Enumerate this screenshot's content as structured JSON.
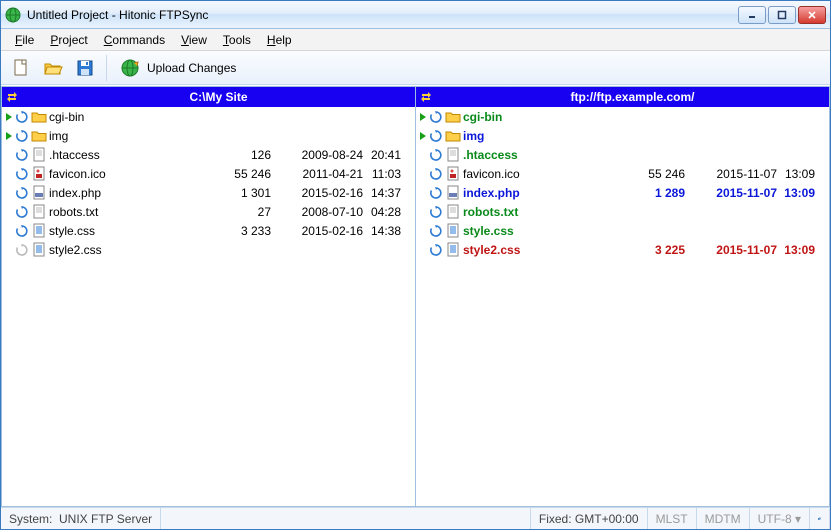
{
  "window": {
    "title": "Untitled Project - Hitonic FTPSync"
  },
  "menu": {
    "file": "File",
    "project": "Project",
    "commands": "Commands",
    "view": "View",
    "tools": "Tools",
    "help": "Help"
  },
  "toolbar": {
    "upload_label": "Upload Changes"
  },
  "panes": {
    "left": {
      "title": "C:\\My Site",
      "items": [
        {
          "type": "dir",
          "name": "cgi-bin",
          "dirflag": "<DIR>",
          "color": "black",
          "arrow": true
        },
        {
          "type": "dir",
          "name": "img",
          "dirflag": "<DIR>",
          "color": "black",
          "arrow": true
        },
        {
          "type": "file",
          "icon": "doc",
          "name": ".htaccess",
          "size": "126",
          "date": "2009-08-24",
          "time": "20:41",
          "color": "black"
        },
        {
          "type": "file",
          "icon": "img",
          "name": "favicon.ico",
          "size": "55 246",
          "date": "2011-04-21",
          "time": "11:03",
          "color": "black"
        },
        {
          "type": "file",
          "icon": "php",
          "name": "index.php",
          "size": "1 301",
          "date": "2015-02-16",
          "time": "14:37",
          "color": "black"
        },
        {
          "type": "file",
          "icon": "doc",
          "name": "robots.txt",
          "size": "27",
          "date": "2008-07-10",
          "time": "04:28",
          "color": "black"
        },
        {
          "type": "file",
          "icon": "css",
          "name": "style.css",
          "size": "3 233",
          "date": "2015-02-16",
          "time": "14:38",
          "color": "black"
        },
        {
          "type": "file",
          "icon": "css",
          "name": "style2.css",
          "size": "",
          "date": "",
          "time": "",
          "color": "black",
          "dim": true
        }
      ]
    },
    "right": {
      "title": "ftp://ftp.example.com/",
      "items": [
        {
          "type": "dir",
          "name": "cgi-bin",
          "dirflag": "<DIR>",
          "color": "green",
          "arrow": true,
          "bold": true
        },
        {
          "type": "dir",
          "name": "img",
          "dirflag": "<DIR>",
          "color": "blue",
          "arrow": true,
          "bold": true
        },
        {
          "type": "file",
          "icon": "doc",
          "name": ".htaccess",
          "size": "",
          "date": "",
          "time": "",
          "color": "green",
          "bold": true
        },
        {
          "type": "file",
          "icon": "img",
          "name": "favicon.ico",
          "size": "55 246",
          "date": "2015-11-07",
          "time": "13:09",
          "color": "black"
        },
        {
          "type": "file",
          "icon": "php",
          "name": "index.php",
          "size": "1 289",
          "date": "2015-11-07",
          "time": "13:09",
          "color": "blue",
          "bold": true
        },
        {
          "type": "file",
          "icon": "doc",
          "name": "robots.txt",
          "size": "",
          "date": "",
          "time": "",
          "color": "green",
          "bold": true
        },
        {
          "type": "file",
          "icon": "css",
          "name": "style.css",
          "size": "",
          "date": "",
          "time": "",
          "color": "green",
          "bold": true
        },
        {
          "type": "file",
          "icon": "css",
          "name": "style2.css",
          "size": "3 225",
          "date": "2015-11-07",
          "time": "13:09",
          "color": "red",
          "bold": true
        }
      ]
    }
  },
  "status": {
    "system_label": "System:",
    "system_value": "UNIX FTP Server",
    "tz": "Fixed: GMT+00:00",
    "mlst": "MLST",
    "mdtm": "MDTM",
    "enc": "UTF-8"
  }
}
